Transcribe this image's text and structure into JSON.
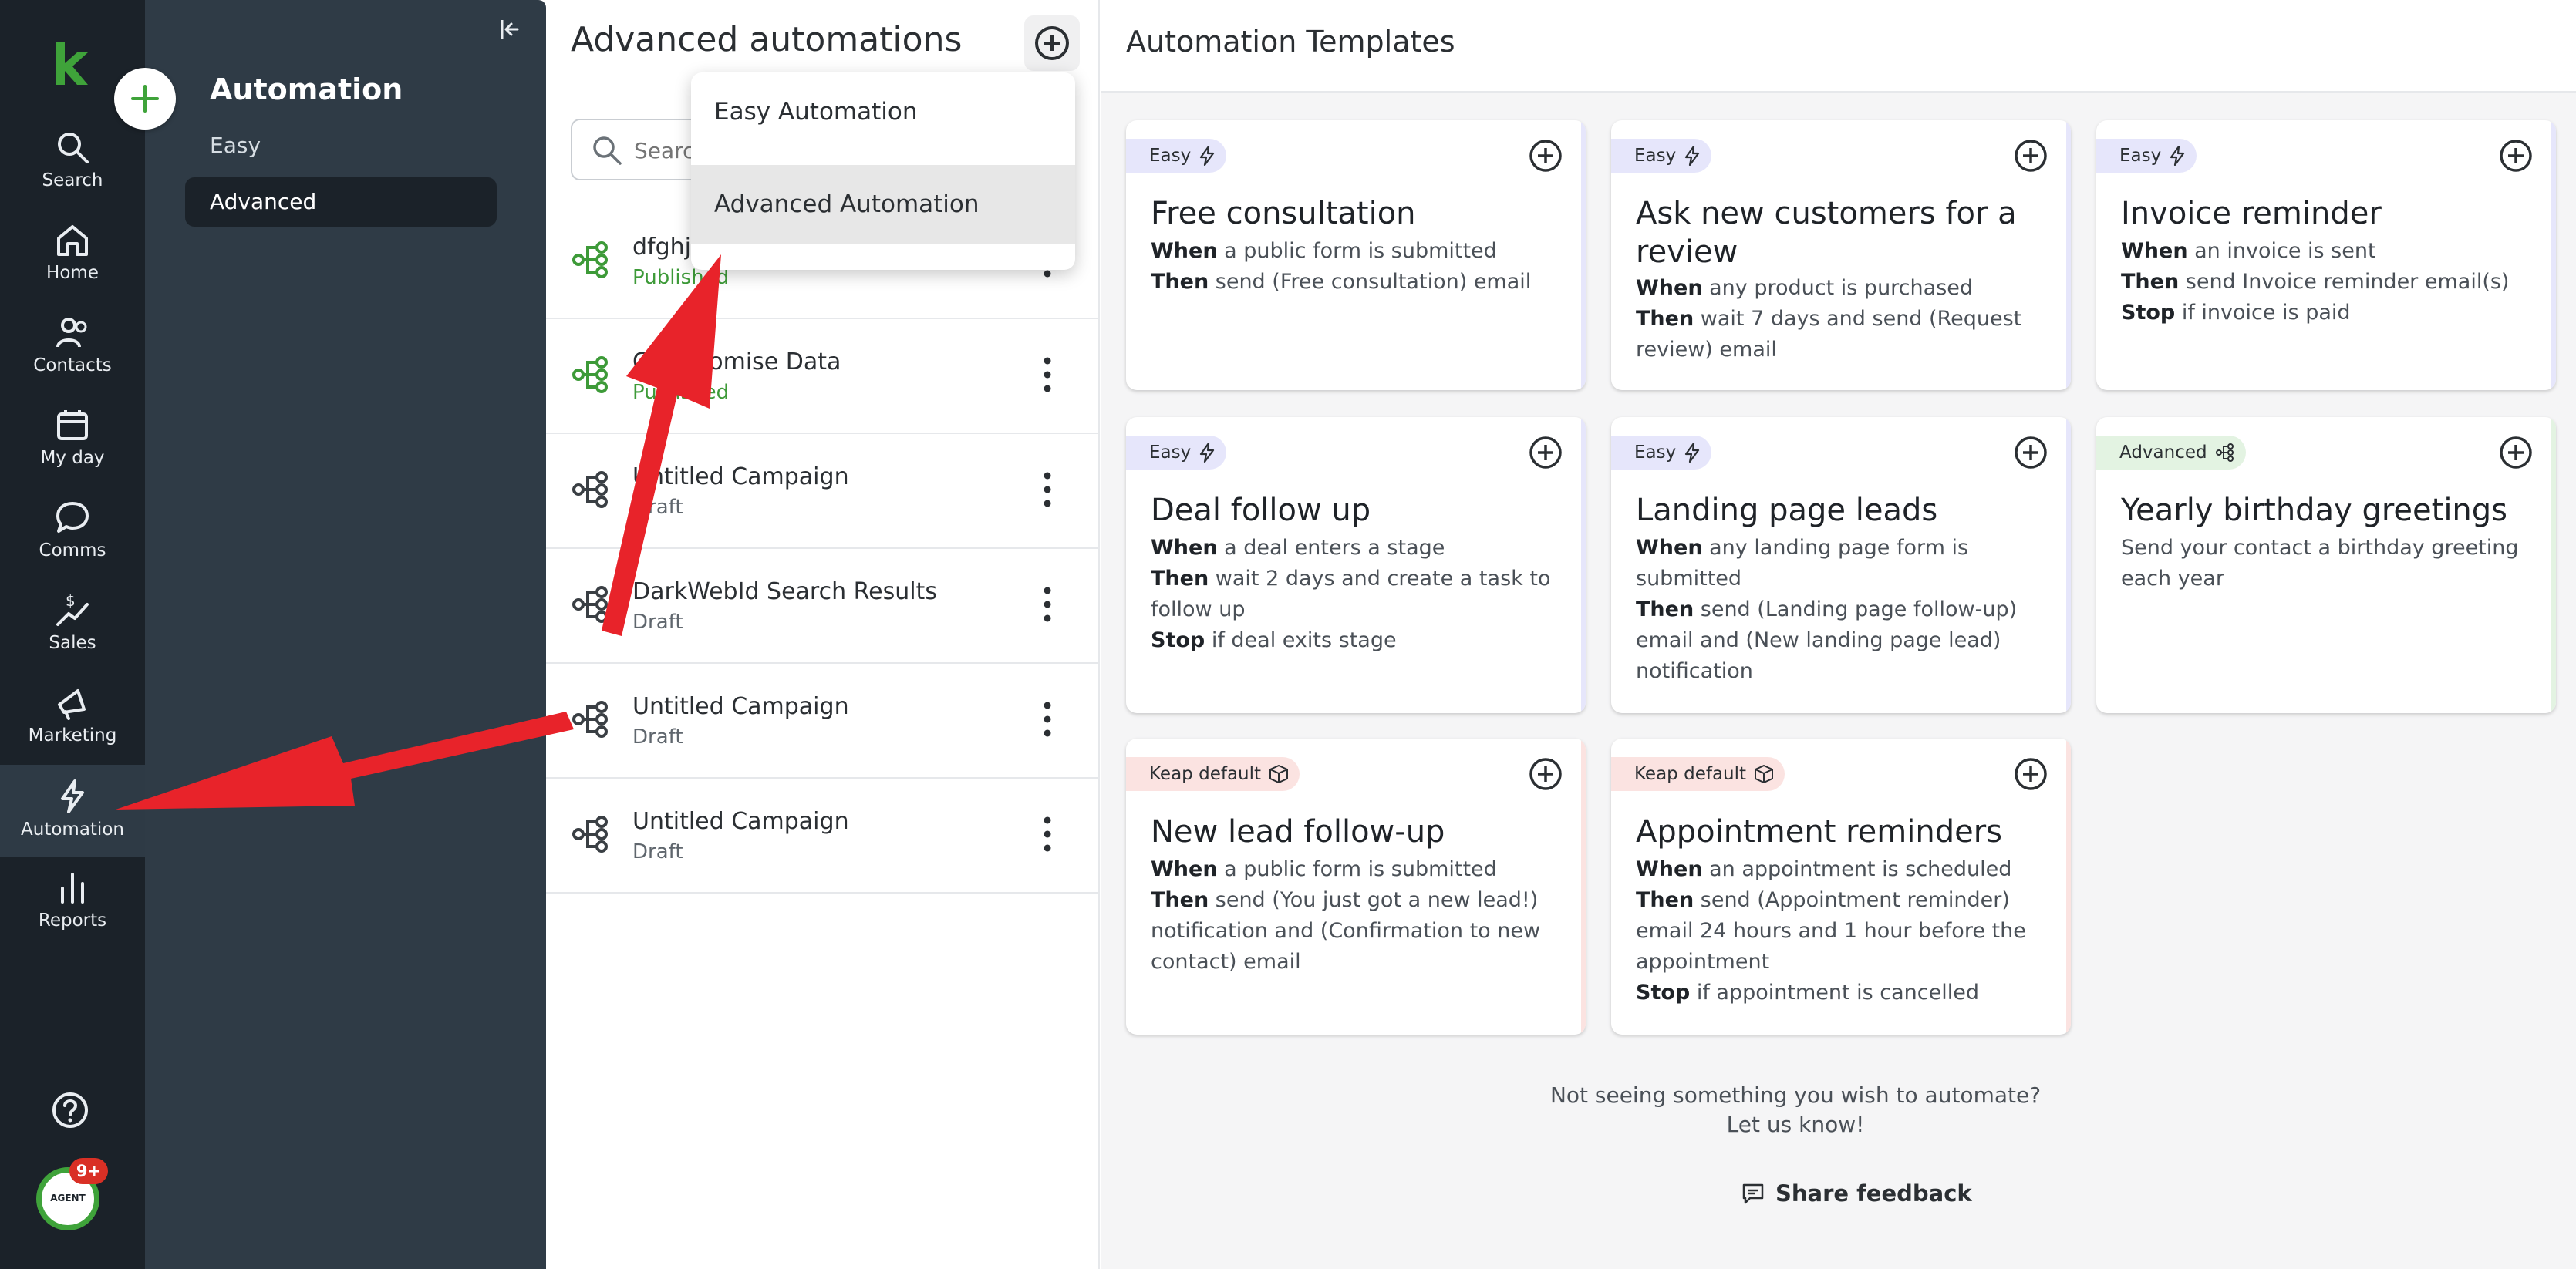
{
  "rail": {
    "items": [
      {
        "label": "Search",
        "icon": "search-icon"
      },
      {
        "label": "Home",
        "icon": "home-icon"
      },
      {
        "label": "Contacts",
        "icon": "contacts-icon"
      },
      {
        "label": "My day",
        "icon": "calendar-icon"
      },
      {
        "label": "Comms",
        "icon": "chat-icon"
      },
      {
        "label": "Sales",
        "icon": "sales-icon"
      },
      {
        "label": "Marketing",
        "icon": "megaphone-icon"
      },
      {
        "label": "Automation",
        "icon": "lightning-icon"
      },
      {
        "label": "Reports",
        "icon": "bar-chart-icon"
      }
    ],
    "active": "Automation",
    "notification_badge": "9+",
    "agent_avatar_text": "AGENT"
  },
  "subnav": {
    "title": "Automation",
    "items": [
      {
        "label": "Easy"
      },
      {
        "label": "Advanced"
      }
    ],
    "selected": "Advanced"
  },
  "list": {
    "title": "Advanced automations",
    "search_placeholder": "Search",
    "rows": [
      {
        "name": "dfghj",
        "status": "Published"
      },
      {
        "name": "Compromise Data",
        "status": "Published"
      },
      {
        "name": "Untitled Campaign",
        "status": "Draft"
      },
      {
        "name": "DarkWebId Search Results",
        "status": "Draft"
      },
      {
        "name": "Untitled Campaign",
        "status": "Draft"
      },
      {
        "name": "Untitled Campaign",
        "status": "Draft"
      }
    ]
  },
  "dropdown": {
    "items": [
      {
        "label": "Easy Automation"
      },
      {
        "label": "Advanced Automation"
      }
    ],
    "hovered": "Advanced Automation"
  },
  "templates": {
    "title": "Automation Templates",
    "cards": [
      {
        "tag": "Easy",
        "title": "Free consultation",
        "lines": [
          [
            "When",
            " a public form is submitted"
          ],
          [
            "Then",
            " send (Free consultation) email"
          ]
        ]
      },
      {
        "tag": "Easy",
        "title": "Ask new customers for a review",
        "lines": [
          [
            "When",
            " any product is purchased"
          ],
          [
            "Then",
            " wait 7 days and send (Request review) email"
          ]
        ]
      },
      {
        "tag": "Easy",
        "title": "Invoice reminder",
        "lines": [
          [
            "When",
            " an invoice is sent"
          ],
          [
            "Then",
            " send Invoice reminder email(s)"
          ],
          [
            "Stop",
            " if invoice is paid"
          ]
        ]
      },
      {
        "tag": "Easy",
        "title": "Deal follow up",
        "lines": [
          [
            "When",
            " a deal enters a stage"
          ],
          [
            "Then",
            " wait 2 days and create a task to follow up"
          ],
          [
            "Stop",
            " if deal exits stage"
          ]
        ]
      },
      {
        "tag": "Easy",
        "title": "Landing page leads",
        "lines": [
          [
            "When",
            " any landing page form is submitted"
          ],
          [
            "Then",
            " send (Landing page follow-up) email and (New landing page lead) notification"
          ]
        ]
      },
      {
        "tag": "Advanced",
        "title": "Yearly birthday greetings",
        "lines": [
          [
            "",
            "Send your contact a birthday greeting each year"
          ]
        ]
      },
      {
        "tag": "Keap default",
        "title": "New lead follow-up",
        "lines": [
          [
            "When",
            " a public form is submitted"
          ],
          [
            "Then",
            " send (You just got a new lead!) notification and (Confirmation to new contact) email"
          ]
        ]
      },
      {
        "tag": "Keap default",
        "title": "Appointment reminders",
        "lines": [
          [
            "When",
            " an appointment is scheduled"
          ],
          [
            "Then",
            " send (Appointment reminder) email 24 hours and 1 hour before the appointment"
          ],
          [
            "Stop",
            " if appointment is cancelled"
          ]
        ]
      }
    ],
    "footer_line1": "Not seeing something you wish to automate?",
    "footer_line2": "Let us know!",
    "feedback_label": "Share feedback"
  },
  "colors": {
    "rail_bg": "#1b2229",
    "subnav_bg": "#2f3b46",
    "brand_green": "#3fa33a",
    "published_green": "#3d9a38",
    "easy_tag": "#e6e6fb",
    "advanced_tag": "#e3f3e2",
    "keap_tag": "#fbe3e1",
    "annotation_red": "#e8232a"
  }
}
